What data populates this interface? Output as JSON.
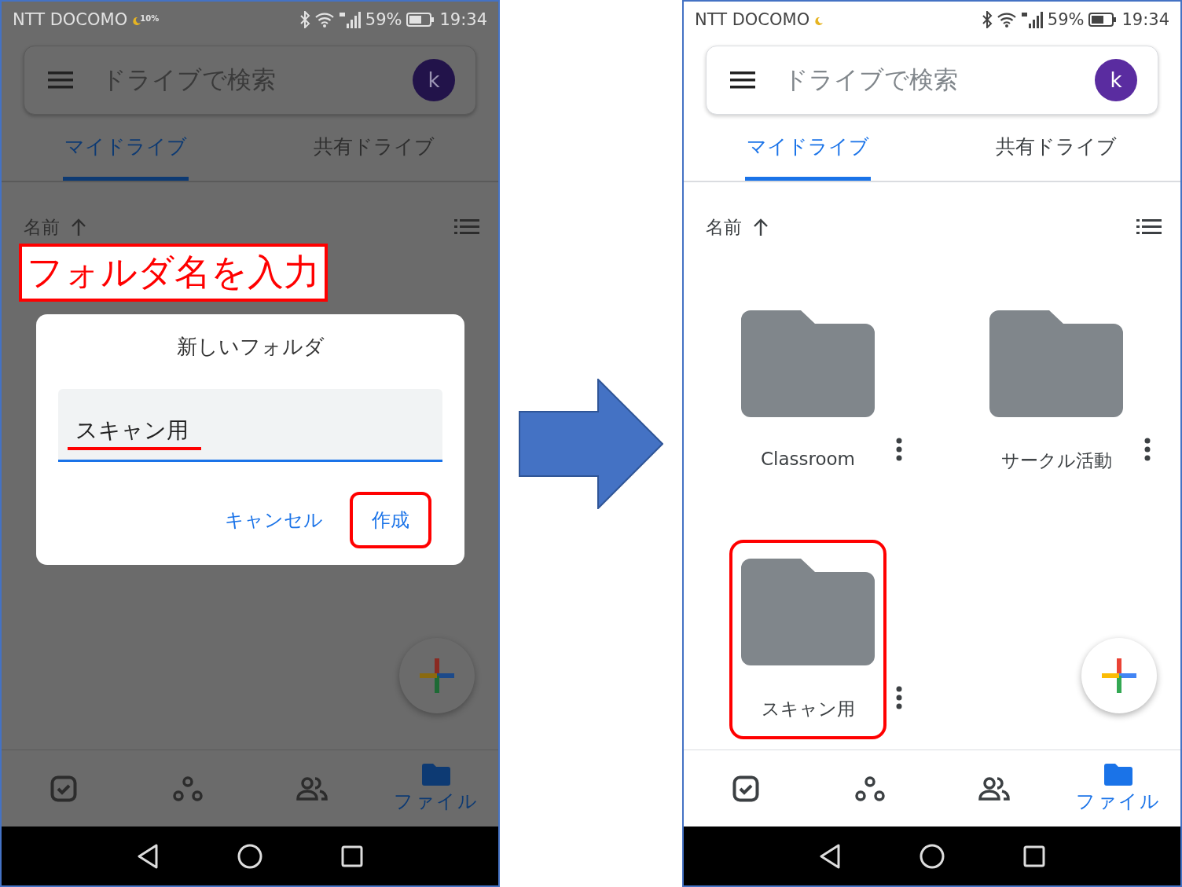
{
  "phones": [
    {
      "dimmed": true,
      "status": {
        "carrier": "NTT DOCOMO",
        "badge": "10%",
        "battery": "59%",
        "time": "19:34"
      },
      "search": {
        "placeholder": "ドライブで検索",
        "avatar": "k"
      },
      "tabs": [
        {
          "label": "マイドライブ",
          "selected": true
        },
        {
          "label": "共有ドライブ",
          "selected": false
        }
      ],
      "sort": {
        "label": "名前"
      },
      "callout": "フォルダ名を入力",
      "dialog": {
        "title": "新しいフォルダ",
        "value": "スキャン用",
        "buttons": [
          {
            "label": "キャンセル",
            "highlighted": false
          },
          {
            "label": "作成",
            "highlighted": true
          }
        ]
      },
      "nav": [
        {
          "kind": "priority",
          "selected": false
        },
        {
          "kind": "workspaces",
          "selected": false
        },
        {
          "kind": "shared",
          "selected": false
        },
        {
          "kind": "files",
          "label": "ファイル",
          "selected": true
        }
      ]
    },
    {
      "dimmed": false,
      "status": {
        "carrier": "NTT DOCOMO",
        "battery": "59%",
        "time": "19:34"
      },
      "search": {
        "placeholder": "ドライブで検索",
        "avatar": "k"
      },
      "tabs": [
        {
          "label": "マイドライブ",
          "selected": true
        },
        {
          "label": "共有ドライブ",
          "selected": false
        }
      ],
      "sort": {
        "label": "名前"
      },
      "folders": [
        {
          "name": "Classroom",
          "highlighted": false
        },
        {
          "name": "サークル活動",
          "highlighted": false
        },
        {
          "name": "スキャン用",
          "highlighted": true
        }
      ],
      "nav": [
        {
          "kind": "priority",
          "selected": false
        },
        {
          "kind": "workspaces",
          "selected": false
        },
        {
          "kind": "shared",
          "selected": false
        },
        {
          "kind": "files",
          "label": "ファイル",
          "selected": true
        }
      ]
    }
  ]
}
